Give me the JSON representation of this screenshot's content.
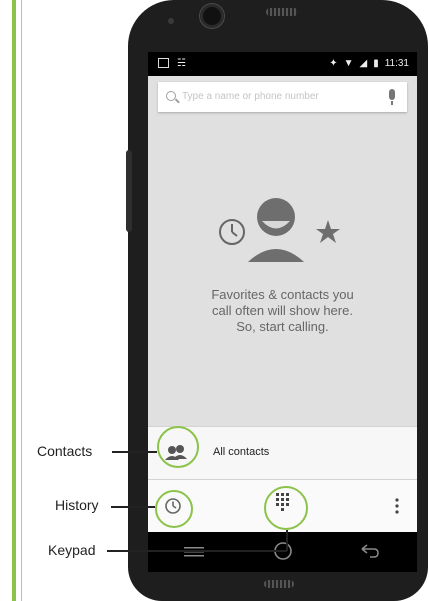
{
  "status_bar": {
    "time": "11:31"
  },
  "search": {
    "placeholder": "Type a name or phone number"
  },
  "empty_state": {
    "lines": [
      "Favorites & contacts you",
      "call often will show here.",
      "So, start calling."
    ]
  },
  "contacts_row": {
    "label": "All contacts"
  },
  "callouts": {
    "contacts": "Contacts",
    "history": "History",
    "keypad": "Keypad"
  },
  "colors": {
    "highlight_ring": "#8bc34a",
    "screen_bg": "#e0e0e0",
    "icon_gray": "#555555"
  }
}
